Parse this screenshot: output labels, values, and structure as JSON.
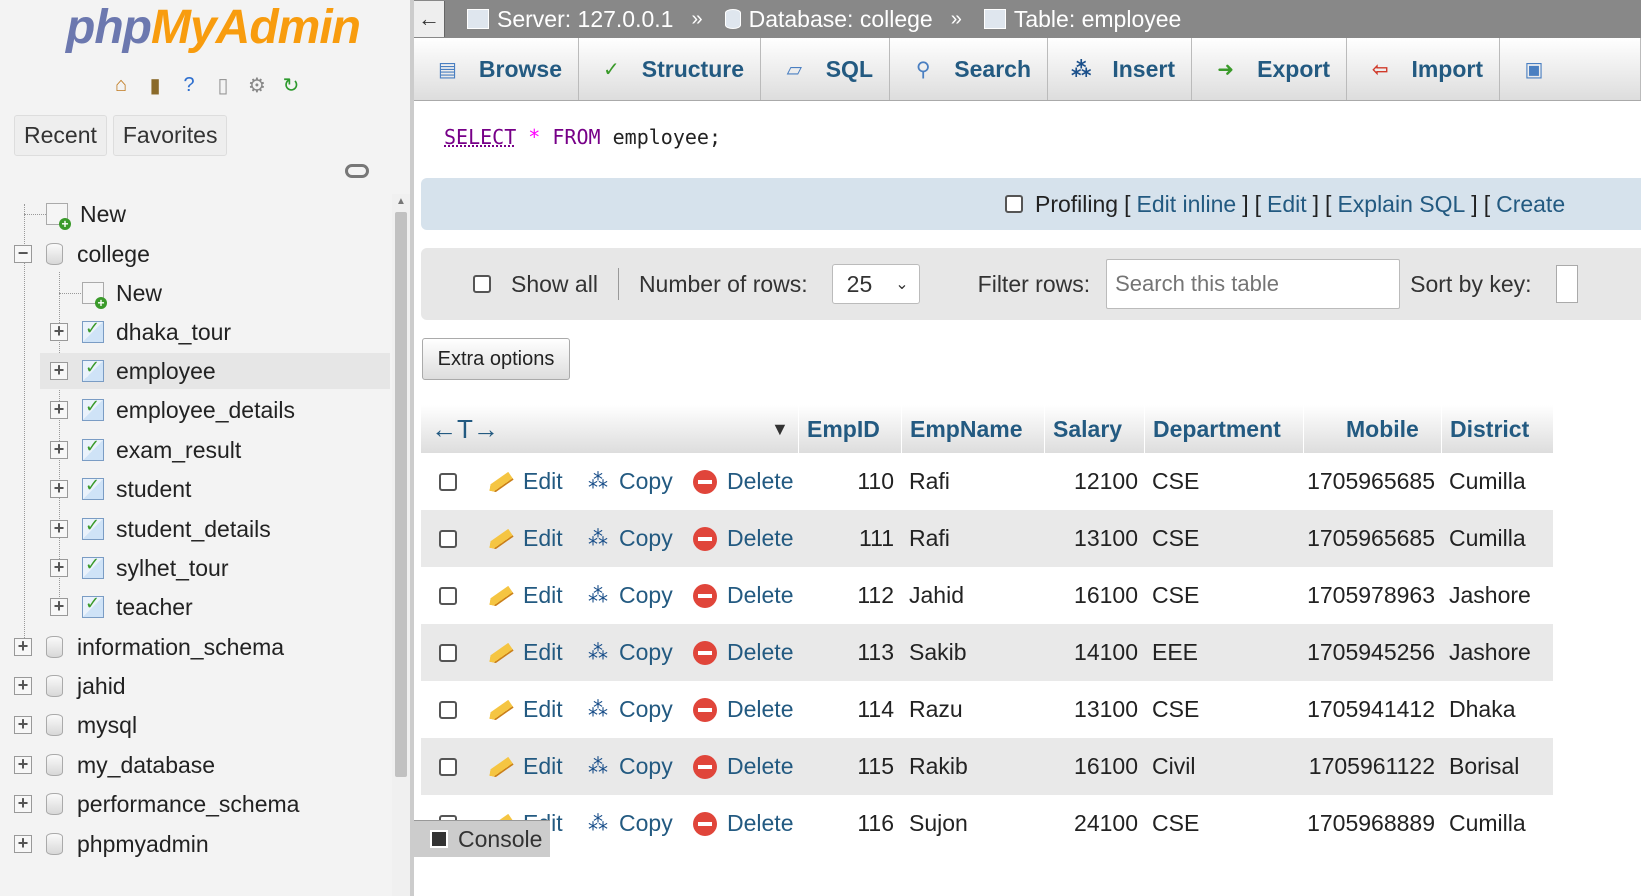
{
  "sidebar": {
    "logo_part1": "php",
    "logo_part2": "MyAdmin",
    "tabs": [
      "Recent",
      "Favorites"
    ],
    "tree": [
      {
        "label": "New"
      },
      {
        "label": "college"
      },
      {
        "label": "New"
      },
      {
        "label": "dhaka_tour"
      },
      {
        "label": "employee"
      },
      {
        "label": "employee_details"
      },
      {
        "label": "exam_result"
      },
      {
        "label": "student"
      },
      {
        "label": "student_details"
      },
      {
        "label": "sylhet_tour"
      },
      {
        "label": "teacher"
      },
      {
        "label": "information_schema"
      },
      {
        "label": "jahid"
      },
      {
        "label": "mysql"
      },
      {
        "label": "my_database"
      },
      {
        "label": "performance_schema"
      },
      {
        "label": "phpmyadmin"
      }
    ]
  },
  "breadcrumb": {
    "server": "Server: 127.0.0.1",
    "database": "Database: college",
    "table": "Table: employee",
    "separator": "»",
    "back": "←"
  },
  "tabs": [
    "Browse",
    "Structure",
    "SQL",
    "Search",
    "Insert",
    "Export",
    "Import"
  ],
  "sql": {
    "select": "SELECT",
    "star": "*",
    "from": "FROM",
    "table": "employee;"
  },
  "profiling": {
    "label": "Profiling",
    "links": [
      "Edit inline",
      "Edit",
      "Explain SQL",
      "Create"
    ]
  },
  "nav": {
    "show_all": "Show all",
    "rows_label": "Number of rows:",
    "rows_value": "25",
    "filter_label": "Filter rows:",
    "filter_placeholder": "Search this table",
    "sort_label": "Sort by key:"
  },
  "extra_options": "Extra options",
  "table": {
    "columns": [
      "EmpID",
      "EmpName",
      "Salary",
      "Department",
      "Mobile",
      "District"
    ],
    "actions": {
      "edit": "Edit",
      "copy": "Copy",
      "delete": "Delete"
    },
    "rows": [
      [
        "110",
        "Rafi",
        "12100",
        "CSE",
        "1705965685",
        "Cumilla"
      ],
      [
        "111",
        "Rafi",
        "13100",
        "CSE",
        "1705965685",
        "Cumilla"
      ],
      [
        "112",
        "Jahid",
        "16100",
        "CSE",
        "1705978963",
        "Jashore"
      ],
      [
        "113",
        "Sakib",
        "14100",
        "EEE",
        "1705945256",
        "Jashore"
      ],
      [
        "114",
        "Razu",
        "13100",
        "CSE",
        "1705941412",
        "Dhaka"
      ],
      [
        "115",
        "Rakib",
        "16100",
        "Civil",
        "1705961122",
        "Borisal"
      ],
      [
        "116",
        "Sujon",
        "24100",
        "CSE",
        "1705968889",
        "Cumilla"
      ]
    ]
  },
  "console": "Console",
  "colors": {
    "link": "#235a81",
    "keyword": "#770088",
    "logo_blue": "#6c78af",
    "logo_orange": "#f89c0e"
  }
}
